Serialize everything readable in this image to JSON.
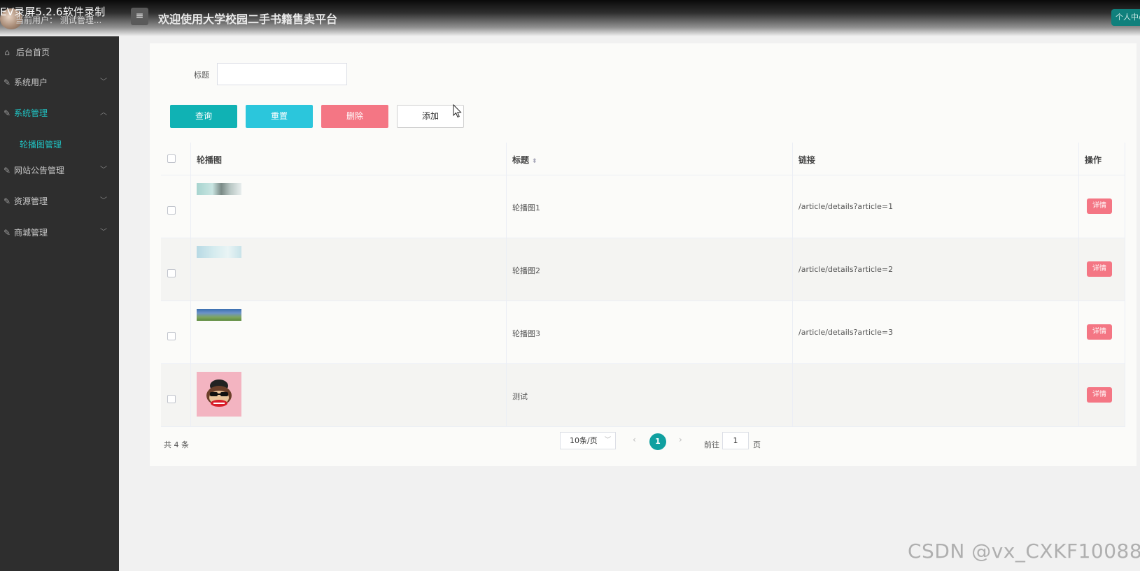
{
  "recorder_watermark": "EV录屏5.2.6软件录制",
  "header": {
    "current_user": "当前用户：  测试管理...",
    "menu_toggle_icon": "≡",
    "title": "欢迎使用大学校园二手书籍售卖平台",
    "personal_center": "个人中心"
  },
  "sidebar": {
    "items": [
      {
        "label": "后台首页",
        "icon": "home-icon",
        "glyph": "⌂"
      },
      {
        "label": "系统用户",
        "icon": "edit-icon",
        "glyph": "✎",
        "chevron": "﹀"
      },
      {
        "label": "系统管理",
        "icon": "edit-icon",
        "glyph": "✎",
        "chevron": "︿"
      },
      {
        "label": "网站公告管理",
        "icon": "edit-icon",
        "glyph": "✎",
        "chevron": "﹀"
      },
      {
        "label": "资源管理",
        "icon": "edit-icon",
        "glyph": "✎",
        "chevron": "﹀"
      },
      {
        "label": "商城管理",
        "icon": "edit-icon",
        "glyph": "✎",
        "chevron": "﹀"
      }
    ],
    "subitem": "轮播图管理"
  },
  "search": {
    "label": "标题",
    "value": ""
  },
  "buttons": {
    "query": "查询",
    "reset": "重置",
    "delete": "删除",
    "add": "添加"
  },
  "table": {
    "headers": {
      "image": "轮播图",
      "title": "标题",
      "link": "链接",
      "actions": "操作"
    },
    "rows": [
      {
        "title": "轮播图1",
        "link": "/article/details?article=1",
        "action": "详情"
      },
      {
        "title": "轮播图2",
        "link": "/article/details?article=2",
        "action": "详情"
      },
      {
        "title": "轮播图3",
        "link": "/article/details?article=3",
        "action": "详情"
      },
      {
        "title": "测试",
        "link": "",
        "action": "详情"
      }
    ]
  },
  "pagination": {
    "total": "共 4 条",
    "page_size": "10条/页",
    "prev": "‹",
    "current_page": "1",
    "next": "›",
    "goto_label": "前往",
    "goto_value": "1",
    "goto_suffix": "页"
  },
  "csdn_watermark": "CSDN @vx_CXKF10088",
  "colors": {
    "accent": "#10b2b4",
    "reset": "#2bc6dc",
    "danger": "#f47684",
    "sidebar_bg": "#2e2e2e",
    "active_text": "#20c3c3"
  }
}
